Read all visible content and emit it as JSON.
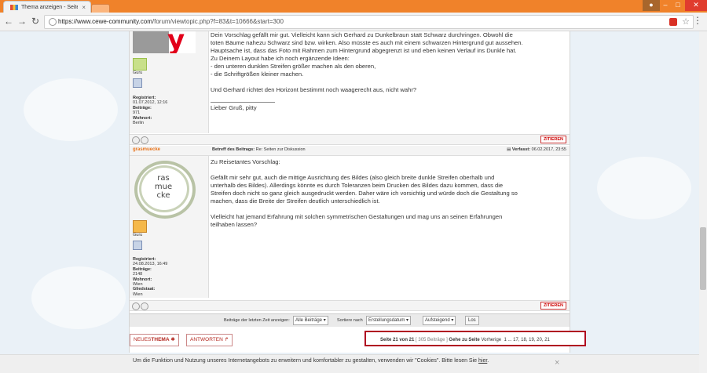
{
  "browser": {
    "tab_title": "Thema anzeigen - Seiter",
    "tab_close": "×",
    "url_host": "https://www.cewe-community.com",
    "url_path": "/forum/viewtopic.php?f=83&t=10666&start=300"
  },
  "post1": {
    "rank_label": "Guru",
    "registriert_label": "Registriert:",
    "registriert": "01.07.2012, 12:16",
    "beitraege_label": "Beiträge:",
    "beitraege": "971",
    "wohnort_label": "Wohnort:",
    "wohnort": "Berlin",
    "lines": [
      "Dein Vorschlag gefällt mir gut. Vielleicht kann sich Gerhard zu Dunkelbraun statt Schwarz durchringen. Obwohl die",
      "toten Bäume nahezu Schwarz sind bzw. wirken. Also müsste es auch mit einem schwarzen Hintergrund gut aussehen.",
      "Hauptsache ist, dass das Foto mit Rahmen zum Hintergrund abgegrenzt ist und eben keinen Verlauf ins Dunkle hat.",
      "Zu Deinem Layout habe ich noch ergänzende Ideen:",
      "- den unteren dunklen Streifen größer machen als den oberen,",
      "- die Schriftgrößen kleiner machen.",
      "Und Gerhard richtet den Horizont bestimmt noch waagerecht aus, nicht wahr?",
      "Lieber Gruß, pitty"
    ],
    "zitieren": "ZITIEREN"
  },
  "post2": {
    "author": "grasmuecke",
    "subject_label": "Betreff des Beitrags:",
    "subject": "Re: Seiten zur Diskussion",
    "verfasst_label": "Verfasst:",
    "verfasst": "06.02.2017, 23:55",
    "avatar_text": [
      "ras",
      "mue",
      "cke"
    ],
    "avatar_letter": "G",
    "rank_label": "Guru",
    "registriert_label": "Registriert:",
    "registriert": "24.08.2013, 16:49",
    "beitraege_label": "Beiträge:",
    "beitraege": "2148",
    "wohnort_label": "Wohnort:",
    "wohnort": "Wien",
    "gliedstaat_label": "Gliedstaat:",
    "gliedstaat": "Wien",
    "lines": [
      "Zu Reisetantes Vorschlag:",
      "Gefällt mir sehr gut, auch die mittige Ausrichtung des Bildes (also gleich breite dunkle Streifen oberhalb und",
      "unterhalb des Bildes). Allerdings könnte es durch Toleranzen beim Drucken des Bildes dazu kommen, dass die",
      "Streifen doch nicht so ganz gleich ausgedruckt werden. Daher wäre ich vorsichtig und würde doch die Gestaltung so",
      "machen, dass die Breite der Streifen deutlich unterschiedlich ist.",
      "Vielleicht hat jemand Erfahrung mit solchen symmetrischen Gestaltungen und mag uns an seinen Erfahrungen",
      "teilhaben lassen?"
    ],
    "zitieren": "ZITIEREN"
  },
  "sortbar": {
    "anzeigen_label": "Beiträge der letzten Zeit anzeigen:",
    "anzeigen_value": "Alle Beiträge",
    "sortieren_label": "Sortiere nach",
    "sortieren_value": "Erstellungsdatum",
    "order_value": "Aufsteigend",
    "go_label": "Los"
  },
  "buttons": {
    "neues_prefix": "NEUES",
    "neues_bold": "THEMA",
    "antworten": "ANTWORTEN"
  },
  "pagination": {
    "seite": "Seite 21 von 21",
    "beitraege": "305 Beiträge",
    "gehe_zu": "Gehe zu Seite",
    "vorherige": "Vorherige",
    "pages": "1 ... 17, 18, 19, 20, 21"
  },
  "cookie": {
    "text": "Um die Funktion und Nutzung unseres Internetangebots zu erweitern und komfortabler zu gestalten, verwenden wir \"Cookies\". Bitte lesen Sie",
    "link": "hier",
    "close": "×"
  }
}
